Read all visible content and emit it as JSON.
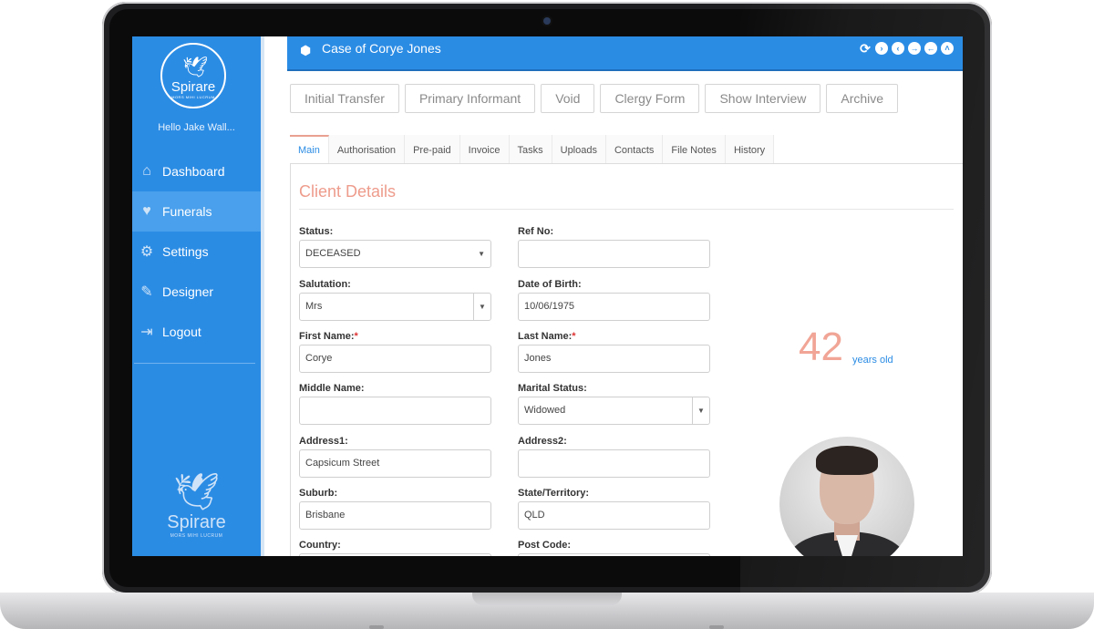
{
  "brand": {
    "name": "Spirare",
    "tagline": "MORS MIHI LUCRUM"
  },
  "user": {
    "greeting": "Hello Jake Wall..."
  },
  "sidebar": {
    "items": [
      {
        "label": "Dashboard",
        "icon": "home-icon",
        "active": false
      },
      {
        "label": "Funerals",
        "icon": "heartbeat-icon",
        "active": true
      },
      {
        "label": "Settings",
        "icon": "gears-icon",
        "active": false
      },
      {
        "label": "Designer",
        "icon": "pencil-icon",
        "active": false
      },
      {
        "label": "Logout",
        "icon": "sign-out-icon",
        "active": false
      }
    ]
  },
  "header": {
    "title": "Case of Corye Jones",
    "icon": "cube-icon",
    "controls": [
      "refresh-icon",
      "chevron-right-circle-icon",
      "chevron-left-circle-icon",
      "arrow-right-circle-icon",
      "arrow-left-circle-icon",
      "chevron-up-circle-icon"
    ]
  },
  "actions": [
    "Initial Transfer",
    "Primary Informant",
    "Void",
    "Clergy Form",
    "Show Interview",
    "Archive"
  ],
  "tabs": [
    {
      "label": "Main",
      "active": true
    },
    {
      "label": "Authorisation",
      "active": false
    },
    {
      "label": "Pre-paid",
      "active": false
    },
    {
      "label": "Invoice",
      "active": false
    },
    {
      "label": "Tasks",
      "active": false
    },
    {
      "label": "Uploads",
      "active": false
    },
    {
      "label": "Contacts",
      "active": false
    },
    {
      "label": "File Notes",
      "active": false
    },
    {
      "label": "History",
      "active": false
    }
  ],
  "form": {
    "title": "Client Details",
    "status": {
      "label": "Status:",
      "value": "DECEASED"
    },
    "ref_no": {
      "label": "Ref No:",
      "value": ""
    },
    "salutation": {
      "label": "Salutation:",
      "value": "Mrs"
    },
    "dob": {
      "label": "Date of Birth:",
      "value": "10/06/1975"
    },
    "first_name": {
      "label": "First Name:",
      "value": "Corye",
      "required": "*"
    },
    "last_name": {
      "label": "Last Name:",
      "value": "Jones",
      "required": "*"
    },
    "middle_name": {
      "label": "Middle Name:",
      "value": ""
    },
    "marital_status": {
      "label": "Marital Status:",
      "value": "Widowed"
    },
    "address1": {
      "label": "Address1:",
      "value": "Capsicum Street"
    },
    "address2": {
      "label": "Address2:",
      "value": ""
    },
    "suburb": {
      "label": "Suburb:",
      "value": "Brisbane"
    },
    "state": {
      "label": "State/Territory:",
      "value": "QLD"
    },
    "country": {
      "label": "Country:"
    },
    "post_code": {
      "label": "Post Code:"
    }
  },
  "age": {
    "value": "42",
    "unit": "years old"
  },
  "colors": {
    "primary": "#2b8ce4",
    "accent": "#ee9c8c"
  }
}
